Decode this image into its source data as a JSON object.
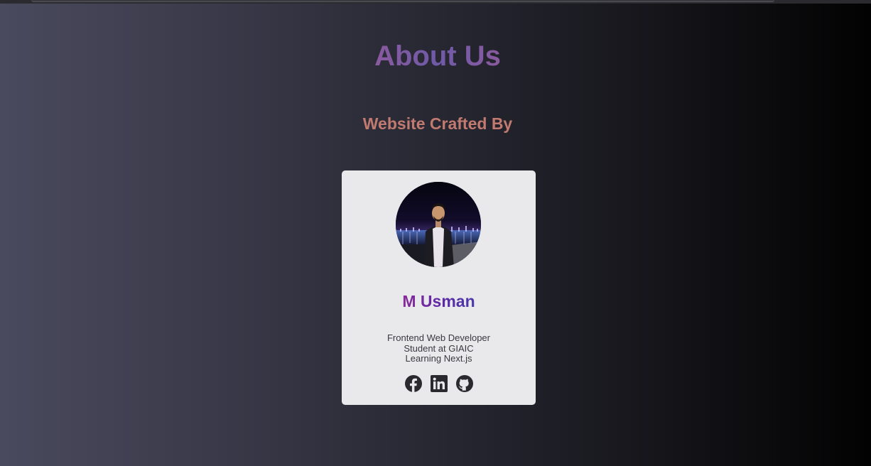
{
  "header": {
    "title": "About Us",
    "subtitle": "Website Crafted By"
  },
  "card": {
    "name": "M Usman",
    "bio": [
      "Frontend Web Developer",
      "Student at GIAIC",
      "Learning Next.js"
    ],
    "avatar_icon": "profile-photo",
    "socials": [
      {
        "icon": "facebook-icon"
      },
      {
        "icon": "linkedin-icon"
      },
      {
        "icon": "github-icon"
      }
    ]
  },
  "colors": {
    "title": "#7d5b9d",
    "subtitle": "#c07a70",
    "name": "#5a2aa8",
    "card_background": "#e9e9ec",
    "icon": "#2a2a2e"
  }
}
